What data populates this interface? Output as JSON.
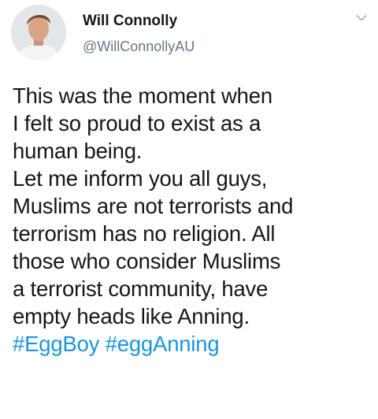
{
  "tweet": {
    "author": {
      "display_name": "Will Connolly",
      "handle": "@WillConnollyAU"
    },
    "body_lines": [
      "This was the moment when",
      "I felt so proud to exist as a",
      "human being.",
      "Let me inform you all guys,",
      "Muslims are not terrorists and",
      "terrorism has no religion. All",
      "those who consider Muslims",
      "a terrorist community, have",
      "empty heads like Anning."
    ],
    "hashtags": [
      "#EggBoy",
      "#eggAnning"
    ]
  },
  "icons": {
    "avatar": "profile-photo",
    "menu": "chevron-down-icon"
  },
  "colors": {
    "text": "#14171a",
    "secondary_text": "#657786",
    "hashtag": "#1b95e0",
    "chevron": "#aab8c2"
  }
}
